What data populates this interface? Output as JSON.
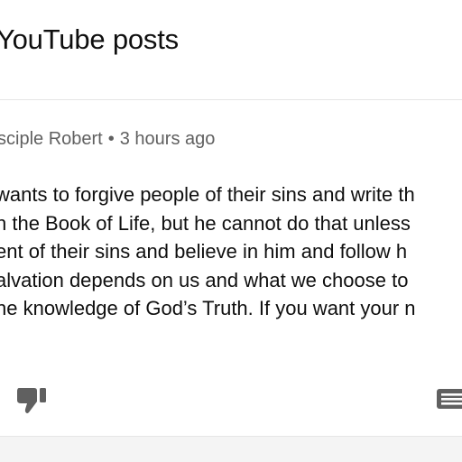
{
  "header": {
    "title": "YouTube posts"
  },
  "post": {
    "author": "sciple Robert",
    "separator": "•",
    "timestamp": "3 hours ago",
    "lines": [
      "wants to forgive people of their sins and write th",
      "n the Book of Life, but he cannot do that unless",
      "ent of their sins and believe in him and follow h",
      "alvation depends on us and what we choose to",
      "he knowledge of God’s Truth. If you want your n"
    ]
  },
  "icons": {
    "dislike": "thumb-down-icon",
    "comment": "comment-icon"
  },
  "colors": {
    "text": "#0f0f0f",
    "meta": "#606060",
    "icon": "#606060",
    "divider": "#e5e5e5"
  }
}
